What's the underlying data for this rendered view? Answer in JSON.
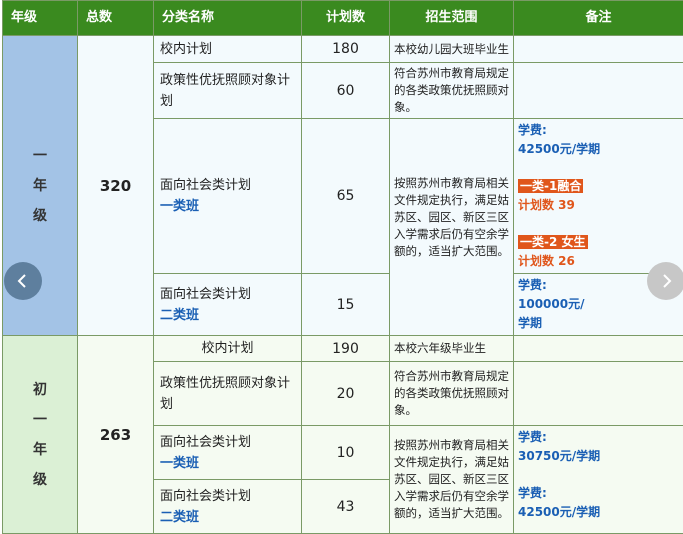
{
  "headers": [
    "年级",
    "总数",
    "分类名称",
    "计划数",
    "招生范围",
    "备注"
  ],
  "groups": [
    {
      "grade_chars": [
        "一",
        "年",
        "级"
      ],
      "total": "320",
      "rows": [
        {
          "name": "校内计划",
          "sub": "",
          "count": "180",
          "range": "本校幼儿园大班毕业生"
        },
        {
          "name": "政策性优抚照顾对象计划",
          "sub": "",
          "count": "60",
          "range": "符合苏州市教育局规定的各类政策优抚照顾对象。"
        },
        {
          "name": "面向社会类计划",
          "sub": "一类班",
          "count": "65",
          "range": "按照苏州市教育局相关文件规定执行，满足姑苏区、园区、新区三区入学需求后仍有空余学额的，适当扩大范围。"
        },
        {
          "name": "面向社会类计划",
          "sub": "二类班",
          "count": "15",
          "range": ""
        }
      ],
      "note_a": {
        "fee_label": "学费:",
        "fee_value": "42500元/学期",
        "class1_tag": "一类-1融合",
        "class1_plan": "计划数 39",
        "class2_tag": "一类-2 女生",
        "class2_plan": "计划数 26"
      },
      "note_b": {
        "fee_label": "学费:",
        "fee_value": "100000元/",
        "fee_unit": "学期"
      }
    },
    {
      "grade_chars": [
        "初",
        "一",
        "年",
        "级"
      ],
      "total": "263",
      "rows": [
        {
          "name": "校内计划",
          "sub": "",
          "count": "190",
          "range": "本校六年级毕业生"
        },
        {
          "name": "政策性优抚照顾对象计划",
          "sub": "",
          "count": "20",
          "range": "符合苏州市教育局规定的各类政策优抚照顾对象。"
        },
        {
          "name": "面向社会类计划",
          "sub": "一类班",
          "count": "10",
          "range": "按照苏州市教育局相关文件规定执行，满足姑苏区、园区、新区三区入学需求后仍有空余学额的，适当扩大范围。"
        },
        {
          "name": "面向社会类计划",
          "sub": "二类班",
          "count": "43",
          "range": ""
        }
      ],
      "note_a": {
        "fee_label": "学费:",
        "fee_value": "30750元/学期"
      },
      "note_b": {
        "fee_label": "学费:",
        "fee_value": "42500元/学期"
      }
    }
  ],
  "icons": {
    "prev": "chevron-left-icon",
    "next": "chevron-right-icon"
  }
}
